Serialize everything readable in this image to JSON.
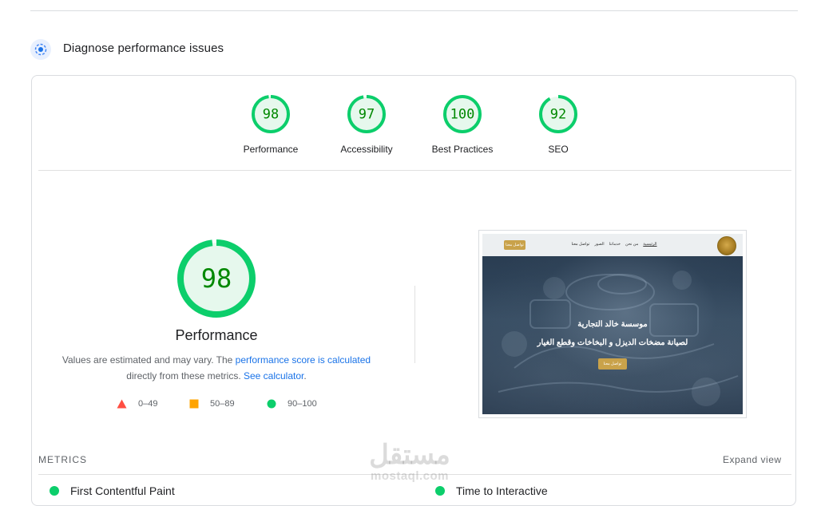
{
  "section": {
    "title": "Diagnose performance issues"
  },
  "colors": {
    "pass": "#0cce6b",
    "pass_bg": "#e6f8ed",
    "pass_text": "#008800",
    "link": "#1a73e8",
    "average": "#ffa400",
    "fail": "#ff4e42"
  },
  "gauges": [
    {
      "score": "98",
      "fraction": 0.98,
      "label": "Performance"
    },
    {
      "score": "97",
      "fraction": 0.97,
      "label": "Accessibility"
    },
    {
      "score": "100",
      "fraction": 1.0,
      "label": "Best Practices"
    },
    {
      "score": "92",
      "fraction": 0.92,
      "label": "SEO"
    }
  ],
  "main_gauge": {
    "score": "98",
    "fraction": 0.98,
    "label": "Performance"
  },
  "description": {
    "text1": "Values are estimated and may vary. The ",
    "link1": "performance score is calculated",
    "text2": "directly from these metrics. ",
    "link2": "See calculator",
    "text3": "."
  },
  "legend": [
    {
      "icon": "triangle-icon",
      "range": "0–49"
    },
    {
      "icon": "square-icon",
      "range": "50–89"
    },
    {
      "icon": "circle-icon",
      "range": "90–100"
    }
  ],
  "screenshot": {
    "heading1": "موسسة خالد التجارية",
    "heading2": "لصيانة مضخات الديزل و البخاخات وقطع الغيار",
    "nav_links": [
      "الرئيسية",
      "من نحن",
      "خدماتنا",
      "الصور",
      "تواصل معنا"
    ],
    "nav_button": "تواصل معنا",
    "hero_button": "تواصل معنا"
  },
  "metrics": {
    "title": "METRICS",
    "expand_label": "Expand view",
    "items": [
      "First Contentful Paint",
      "Time to Interactive"
    ]
  },
  "watermark": {
    "arabic": "مستقل",
    "latin": "mostaql.com"
  }
}
